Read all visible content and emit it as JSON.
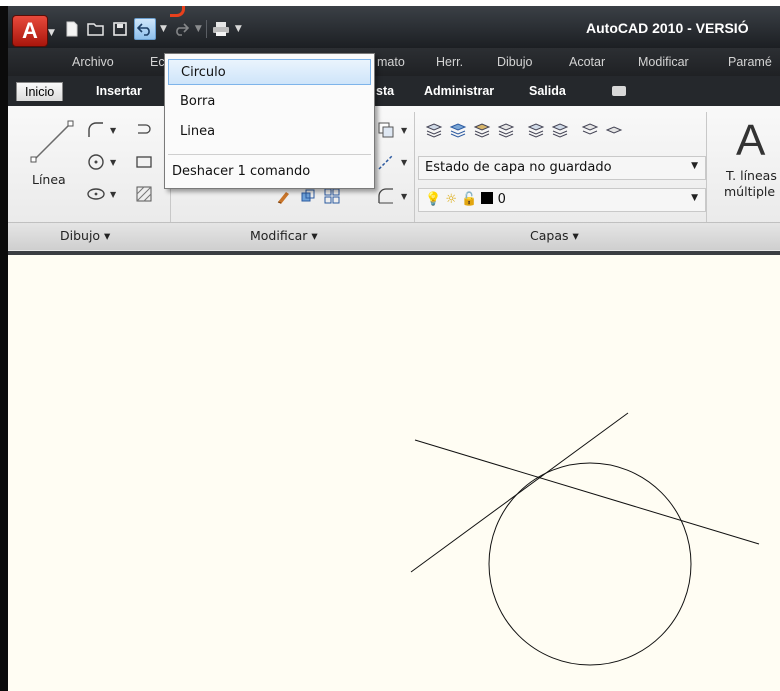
{
  "window": {
    "title": "AutoCAD 2010 - VERSIÓ"
  },
  "app_button": {
    "label": "A"
  },
  "quick_access": {
    "icons": [
      "new-icon",
      "open-icon",
      "save-icon",
      "undo-icon",
      "redo-icon",
      "plot-icon"
    ]
  },
  "menubar": {
    "items": [
      "Archivo",
      "Ec",
      "mato",
      "Herr.",
      "Dibujo",
      "Acotar",
      "Modificar",
      "Paramé"
    ]
  },
  "ribbon_tabs": {
    "items": [
      "Inicio",
      "Insertar",
      "sta",
      "Administrar",
      "Salida"
    ],
    "selected": "Inicio"
  },
  "ribbon": {
    "draw": {
      "line_label": "Línea",
      "panel_title": "Dibujo"
    },
    "modify": {
      "panel_title": "Modificar"
    },
    "layers": {
      "layer_state_value": "Estado de capa no guardado",
      "current_layer_value": "0",
      "panel_title": "Capas"
    },
    "annotation": {
      "big_label": "A",
      "mline_label_1": "T. líneas",
      "mline_label_2": "múltiple"
    }
  },
  "undo_dropdown": {
    "items": [
      "Circulo",
      "Borra",
      "Linea"
    ],
    "highlighted": "Circulo",
    "footer": "Deshacer 1 comando"
  },
  "drawing": {
    "background": "#fffdf3",
    "entities": [
      "line",
      "line",
      "circle"
    ]
  }
}
